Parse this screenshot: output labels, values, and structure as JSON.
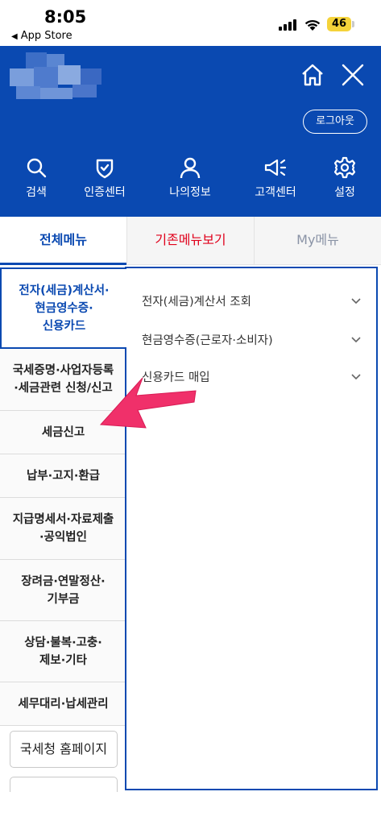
{
  "status_bar": {
    "time": "8:05",
    "back_label": "App Store",
    "battery": "46"
  },
  "header": {
    "logout_label": "로그아웃"
  },
  "quick_menu": [
    {
      "label": "검색",
      "icon": "search-icon"
    },
    {
      "label": "인증센터",
      "icon": "shield-icon"
    },
    {
      "label": "나의정보",
      "icon": "user-icon"
    },
    {
      "label": "고객센터",
      "icon": "megaphone-icon"
    },
    {
      "label": "설정",
      "icon": "gear-icon"
    }
  ],
  "tabs": {
    "all": "전체메뉴",
    "old": "기존메뉴보기",
    "my": "My메뉴"
  },
  "categories": [
    {
      "label": "전자(세금)계산서·\n현금영수증·\n신용카드",
      "active": true
    },
    {
      "label": "국세증명·사업자등록\n·세금관련 신청/신고"
    },
    {
      "label": "세금신고"
    },
    {
      "label": "납부·고지·환급"
    },
    {
      "label": "지급명세서·자료제출\n·공익법인"
    },
    {
      "label": "장려금·연말정산·\n기부금"
    },
    {
      "label": "상담·불복·고충·\n제보·기타"
    },
    {
      "label": "세무대리·납세관리"
    }
  ],
  "home_links": [
    "국세청 홈페이지"
  ],
  "submenu": [
    {
      "label": "전자(세금)계산서 조회"
    },
    {
      "label": "현금영수증(근로자·소비자)"
    },
    {
      "label": "신용카드 매입"
    }
  ],
  "colors": {
    "primary": "#0a49b1",
    "accent_red": "#e0001b",
    "arrow": "#f0306a"
  }
}
